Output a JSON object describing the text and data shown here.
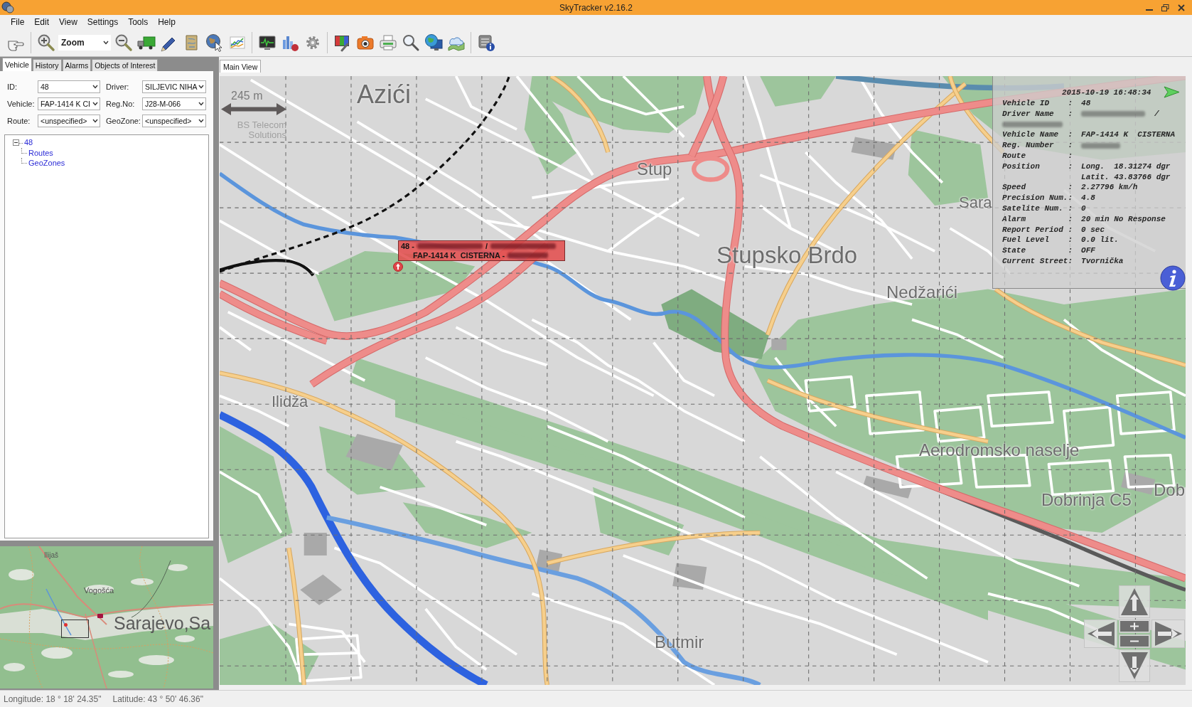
{
  "window": {
    "title": "SkyTracker v2.16.2"
  },
  "menu": [
    "File",
    "Edit",
    "View",
    "Settings",
    "Tools",
    "Help"
  ],
  "toolbar": {
    "zoom_mode": {
      "value": "Zoom"
    }
  },
  "left_panel": {
    "tabs": [
      {
        "label": "Vehicle",
        "selected": true
      },
      {
        "label": "History",
        "selected": false
      },
      {
        "label": "Alarms",
        "selected": false
      },
      {
        "label": "Objects of Interest",
        "selected": false
      }
    ],
    "filters": [
      {
        "label": "ID:",
        "value": "48"
      },
      {
        "label": "Driver:",
        "value": "SILJEVIC NIHA"
      },
      {
        "label": "Vehicle:",
        "value": "FAP-1414 K CI"
      },
      {
        "label": "Reg.No:",
        "value": "J28-M-066"
      },
      {
        "label": "Route:",
        "value": "<unspecified>"
      },
      {
        "label": "GeoZone:",
        "value": "<unspecified>"
      }
    ],
    "tree": [
      {
        "label": "48",
        "expanded": true,
        "children": [
          {
            "label": "Routes"
          },
          {
            "label": "GeoZones"
          }
        ]
      }
    ],
    "overview_map": {
      "labels": [
        "Ilijaš",
        "Vogošća",
        "Sarajevo,Sa"
      ]
    }
  },
  "main_view": {
    "tabs": [
      {
        "label": "Main View",
        "selected": true
      }
    ],
    "map": {
      "place_labels": [
        "Azići",
        "Stup",
        "Stupsko Brdo",
        "Sara",
        "Nedžarići",
        "Ilidža",
        "Aerodromsko naselje",
        "Dobrinja C5",
        "Dob",
        "Butmir"
      ],
      "scale": {
        "distance": "245 m",
        "credit": "BS Telecom Solutions"
      },
      "vehicle_label": {
        "lines": [
          {
            "parts": [
              {
                "kind": "text",
                "text": "48 -"
              },
              {
                "kind": "redacted"
              },
              {
                "kind": "text",
                "text": "/"
              },
              {
                "kind": "redacted"
              }
            ]
          },
          {
            "parts": [
              {
                "kind": "text",
                "text": "FAP-1414 K  CISTERNA -"
              },
              {
                "kind": "redacted"
              }
            ]
          }
        ]
      },
      "info_panel": {
        "timestamp": "2015-10-19 16:48:34",
        "rows": [
          {
            "kind": "field",
            "label": "Vehicle ID    :",
            "values": [
              "48"
            ]
          },
          {
            "kind": "field",
            "label": "Driver Name   :",
            "redacted": true,
            "values": [
              "/"
            ]
          },
          {
            "kind": "redacted_line"
          },
          {
            "kind": "field",
            "label": "Vehicle Name  :",
            "values": [
              "FAP-1414 K  CISTERNA"
            ]
          },
          {
            "kind": "field",
            "label": "Reg. Number   :",
            "redacted": true
          },
          {
            "kind": "field",
            "label": "Route         :"
          },
          {
            "kind": "field",
            "label": "Position      :",
            "values": [
              "Long.  18.31274 dgr",
              "Latit. 43.83766 dgr"
            ]
          },
          {
            "kind": "field",
            "label": "Speed         :",
            "values": [
              "2.27796 km/h"
            ]
          },
          {
            "kind": "field",
            "label": "Precision Num.:",
            "values": [
              "4.8"
            ]
          },
          {
            "kind": "field",
            "label": "Satelite Num. :",
            "values": [
              "0"
            ]
          },
          {
            "kind": "field",
            "label": "Alarm         :",
            "values": [
              "20 min No Response"
            ]
          },
          {
            "kind": "field",
            "label": "Report Period :",
            "values": [
              "0 sec"
            ]
          },
          {
            "kind": "field",
            "label": "Fuel Level    :",
            "values": [
              "0.0 lit."
            ]
          },
          {
            "kind": "field",
            "label": "State         :",
            "values": [
              "OFF"
            ]
          },
          {
            "kind": "field",
            "label": "Current Street:",
            "values": [
              "Tvornička"
            ]
          }
        ]
      }
    }
  },
  "status_bar": {
    "longitude": "Longitude: 18 ° 18' 24.35\"",
    "latitude": "Latitude: 43 ° 50' 46.36\""
  }
}
